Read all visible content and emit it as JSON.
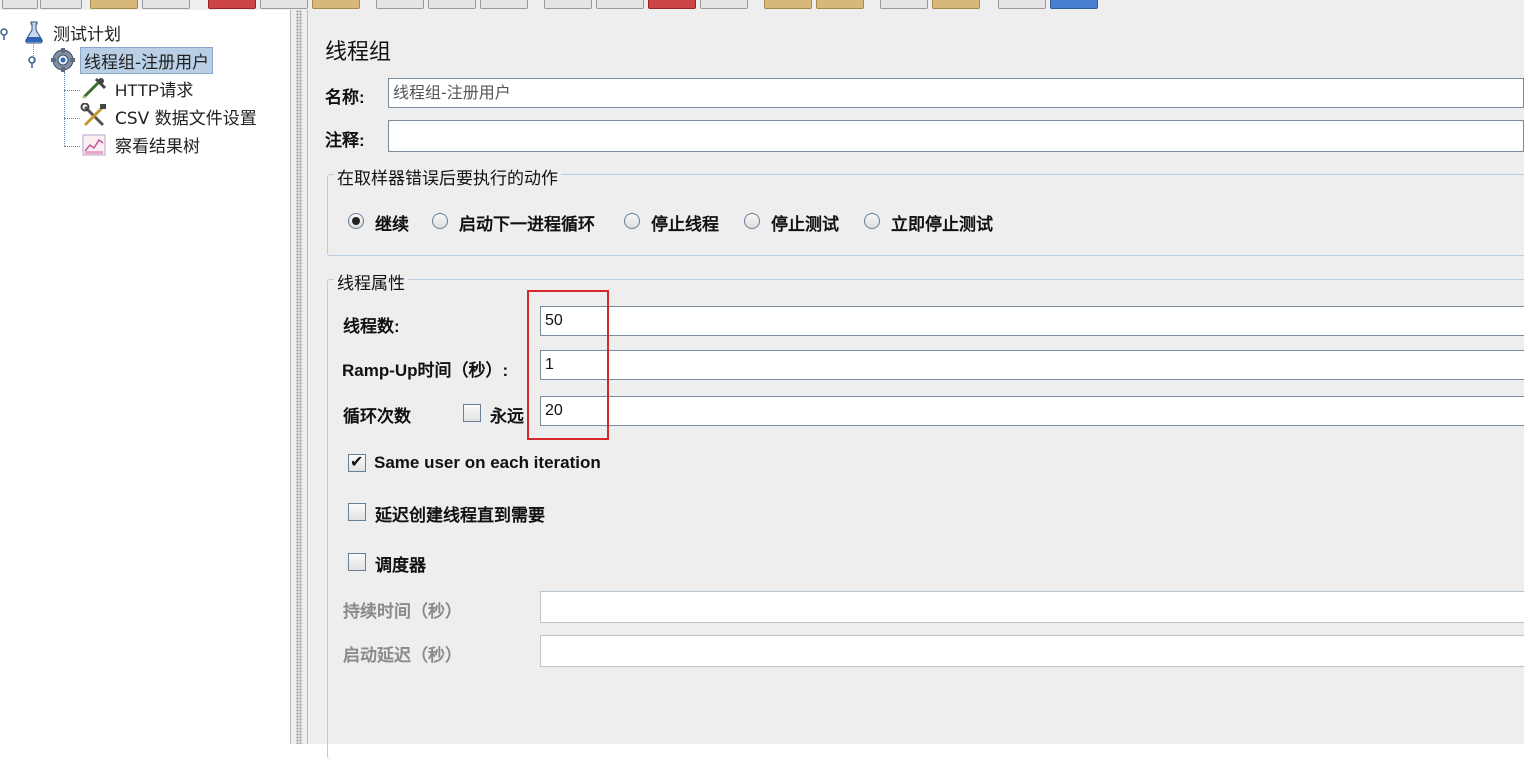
{
  "tree": {
    "nodes": [
      {
        "label": "测试计划",
        "icon": "flask-icon"
      },
      {
        "label": "线程组-注册用户",
        "icon": "gear-icon"
      },
      {
        "label": "HTTP请求",
        "icon": "pipette-icon"
      },
      {
        "label": "CSV 数据文件设置",
        "icon": "tools-icon"
      },
      {
        "label": "察看结果树",
        "icon": "chart-icon"
      }
    ]
  },
  "panel": {
    "title": "线程组",
    "name_label": "名称:",
    "name_value": "线程组-注册用户",
    "comment_label": "注释:",
    "comment_value": "",
    "error_action": {
      "legend": "在取样器错误后要执行的动作",
      "options": [
        "继续",
        "启动下一进程循环",
        "停止线程",
        "停止测试",
        "立即停止测试"
      ],
      "selected": "继续"
    },
    "thread_props": {
      "legend": "线程属性",
      "threads_label": "线程数:",
      "threads_value": "50",
      "rampup_label": "Ramp-Up时间（秒）:",
      "rampup_value": "1",
      "loop_label": "循环次数",
      "forever_label": "永远",
      "forever_checked": false,
      "loop_value": "20",
      "same_user_label": "Same user on each iteration",
      "same_user_checked": true,
      "delay_label": "延迟创建线程直到需要",
      "delay_checked": false,
      "scheduler_label": "调度器",
      "scheduler_checked": false,
      "duration_label": "持续时间（秒）",
      "duration_value": "",
      "startup_delay_label": "启动延迟（秒）",
      "startup_delay_value": ""
    }
  },
  "colors": {
    "highlight": "#d6282a",
    "selection": "#b8cfe5",
    "panel_bg": "#eeeeee"
  }
}
